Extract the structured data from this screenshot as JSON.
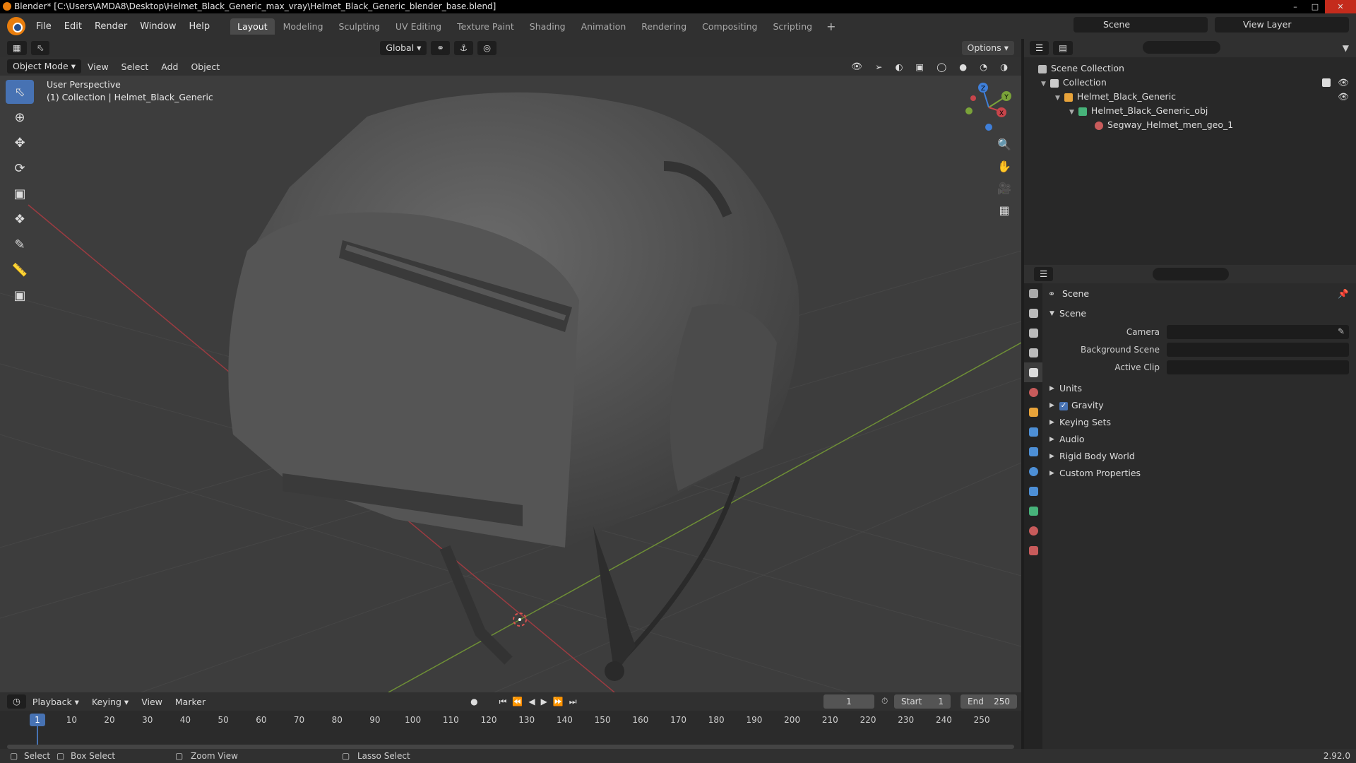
{
  "window": {
    "title": "Blender* [C:\\Users\\AMDA8\\Desktop\\Helmet_Black_Generic_max_vray\\Helmet_Black_Generic_blender_base.blend]"
  },
  "menu": [
    "File",
    "Edit",
    "Render",
    "Window",
    "Help"
  ],
  "workspaces": [
    "Layout",
    "Modeling",
    "Sculpting",
    "UV Editing",
    "Texture Paint",
    "Shading",
    "Animation",
    "Rendering",
    "Compositing",
    "Scripting"
  ],
  "header": {
    "scene": "Scene",
    "view_layer": "View Layer"
  },
  "viewport": {
    "transform_orientation": "Global",
    "options": "Options",
    "mode": "Object Mode",
    "menus": [
      "View",
      "Select",
      "Add",
      "Object"
    ],
    "info_line1": "User Perspective",
    "info_line2": "(1) Collection | Helmet_Black_Generic",
    "axes": {
      "x": "X",
      "y": "Y",
      "z": "Z"
    }
  },
  "outliner": {
    "items": [
      {
        "label": "Scene Collection",
        "icon": "scene-collection-icon"
      },
      {
        "label": "Collection",
        "icon": "collection-icon"
      },
      {
        "label": "Helmet_Black_Generic",
        "icon": "empty-object-icon"
      },
      {
        "label": "Helmet_Black_Generic_obj",
        "icon": "mesh-icon"
      },
      {
        "label": "Segway_Helmet_men_geo_1",
        "icon": "material-icon"
      }
    ]
  },
  "properties": {
    "title": "Scene",
    "panel": "Scene",
    "fields": [
      {
        "label": "Camera"
      },
      {
        "label": "Background Scene"
      },
      {
        "label": "Active Clip"
      }
    ],
    "subpanels": [
      "Units",
      "Gravity",
      "Keying Sets",
      "Audio",
      "Rigid Body World",
      "Custom Properties"
    ]
  },
  "timeline": {
    "menus": [
      "Playback",
      "Keying",
      "View",
      "Marker"
    ],
    "current_frame": "1",
    "start_label": "Start",
    "start": "1",
    "end_label": "End",
    "end": "250",
    "ticks": [
      "1",
      "10",
      "20",
      "30",
      "40",
      "50",
      "60",
      "70",
      "80",
      "90",
      "100",
      "110",
      "120",
      "130",
      "140",
      "150",
      "160",
      "170",
      "180",
      "190",
      "200",
      "210",
      "220",
      "230",
      "240",
      "250"
    ]
  },
  "statusbar": {
    "select": "Select",
    "box_select": "Box Select",
    "zoom_view": "Zoom View",
    "lasso_select": "Lasso Select",
    "version": "2.92.0"
  },
  "colors": {
    "accent": "#4772b3",
    "header": "#303030",
    "viewport_bg": "#3d3d3d",
    "x_axis": "#c8454b",
    "y_axis": "#7aa339",
    "z_axis": "#3f7fd9"
  }
}
